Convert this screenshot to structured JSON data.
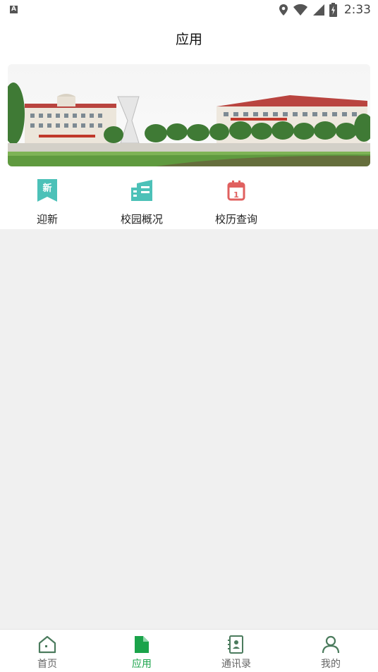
{
  "status_bar": {
    "time": "2:33",
    "indicator": "A"
  },
  "header": {
    "title": "应用"
  },
  "grid": [
    {
      "label": "迎新",
      "icon": "ribbon-new-icon",
      "badge": "新",
      "color": "#4cc1b8"
    },
    {
      "label": "校园概况",
      "icon": "building-icon",
      "color": "#4cc1b8"
    },
    {
      "label": "校历查询",
      "icon": "calendar-icon",
      "badge": "1",
      "color": "#e0605f"
    }
  ],
  "tabbar": [
    {
      "label": "首页",
      "icon": "home-icon",
      "active": false
    },
    {
      "label": "应用",
      "icon": "document-icon",
      "active": true
    },
    {
      "label": "通讯录",
      "icon": "contacts-icon",
      "active": false
    },
    {
      "label": "我的",
      "icon": "user-icon",
      "active": false
    }
  ],
  "colors": {
    "accent": "#1aa34a",
    "inactive_icon": "#4b7b5d",
    "teal": "#4cc1b8",
    "red": "#e0605f"
  }
}
